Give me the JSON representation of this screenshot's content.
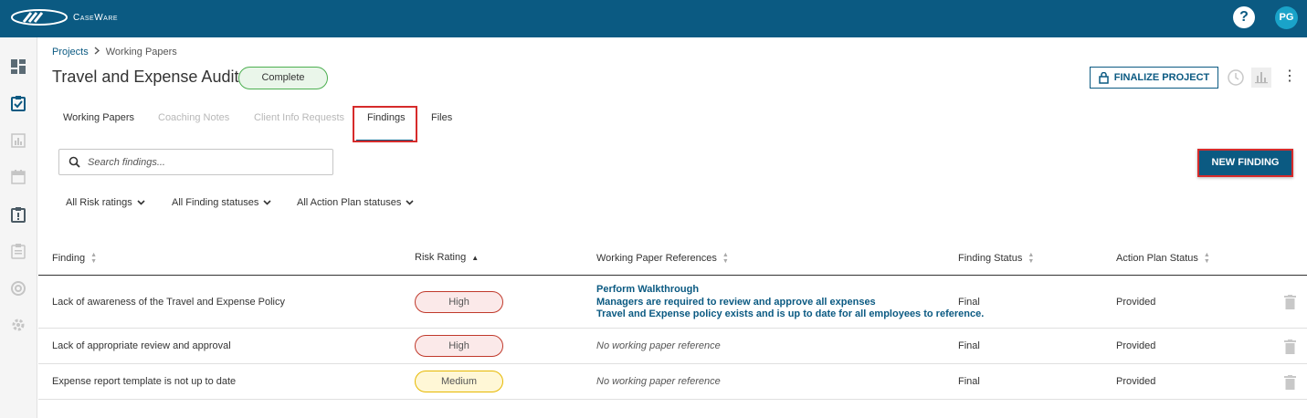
{
  "app": {
    "brand": "CaseWare",
    "help_label": "?",
    "user_initials": "PG"
  },
  "sidebar": {
    "items": [
      {
        "icon": "dashboard-icon"
      },
      {
        "icon": "checklist-icon",
        "active": true
      },
      {
        "icon": "reports-icon"
      },
      {
        "icon": "calendar-icon"
      },
      {
        "icon": "findings-alert-icon"
      },
      {
        "icon": "clipboard-icon"
      },
      {
        "icon": "support-icon"
      },
      {
        "icon": "settings-icon"
      }
    ]
  },
  "breadcrumb": {
    "projects": "Projects",
    "separator": ">",
    "current": "Working Papers"
  },
  "page": {
    "title": "Travel and Expense Audit",
    "status": "Complete"
  },
  "toolbar": {
    "finalize_label": "FINALIZE PROJECT",
    "more_label": "⋮"
  },
  "tabs": [
    {
      "label": "Working Papers",
      "state": "normal"
    },
    {
      "label": "Coaching Notes",
      "state": "disabled"
    },
    {
      "label": "Client Info Requests",
      "state": "disabled"
    },
    {
      "label": "Findings",
      "state": "active"
    },
    {
      "label": "Files",
      "state": "normal"
    }
  ],
  "search": {
    "placeholder": "Search findings...",
    "value": ""
  },
  "new_finding_label": "NEW FINDING",
  "filters": [
    {
      "label": "All Risk ratings"
    },
    {
      "label": "All Finding statuses"
    },
    {
      "label": "All Action Plan statuses"
    }
  ],
  "table": {
    "columns": [
      {
        "label": "Finding",
        "sort": "none"
      },
      {
        "label": "Risk Rating",
        "sort": "asc"
      },
      {
        "label": "Working Paper References",
        "sort": "none"
      },
      {
        "label": "Finding Status",
        "sort": "none"
      },
      {
        "label": "Action Plan Status",
        "sort": "none"
      }
    ],
    "rows": [
      {
        "finding": "Lack of awareness of the Travel and Expense Policy",
        "risk": "High",
        "references": [
          "Perform Walkthrough",
          "Managers are required to review and approve all expenses",
          "Travel and Expense policy exists and is up to date for all employees to reference."
        ],
        "no_reference": "",
        "finding_status": "Final",
        "action_plan_status": "Provided"
      },
      {
        "finding": "Lack of appropriate review and approval",
        "risk": "High",
        "references": [],
        "no_reference": "No working paper reference",
        "finding_status": "Final",
        "action_plan_status": "Provided"
      },
      {
        "finding": "Expense report template is not up to date",
        "risk": "Medium",
        "references": [],
        "no_reference": "No working paper reference",
        "finding_status": "Final",
        "action_plan_status": "Provided"
      }
    ]
  },
  "colors": {
    "brand": "#0b5a82",
    "highlight": "#d62b2b",
    "complete": "#4caf50",
    "high": "#c0392b",
    "medium": "#e6b800"
  }
}
